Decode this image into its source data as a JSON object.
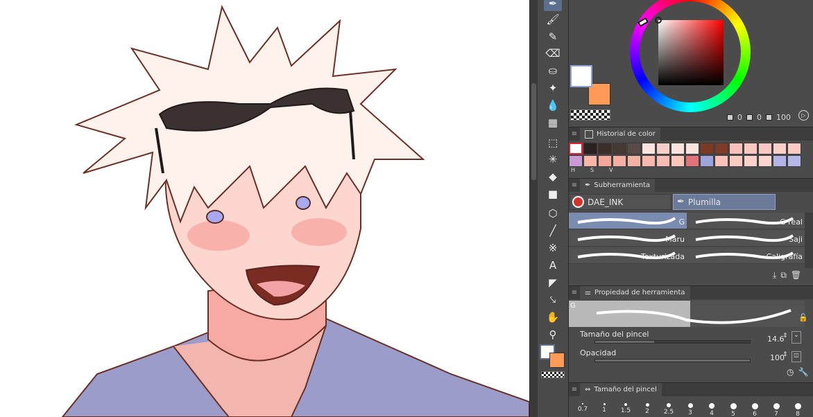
{
  "canvas": {
    "artwork": "illustration of a white-haired young man with sunglasses on his head"
  },
  "color_panel": {
    "hsv_h": "0",
    "hsv_s": "0",
    "hsv_v": "100",
    "main_color": "#ffffff",
    "sub_color": "#ff9a57"
  },
  "color_history": {
    "title": "Historial de color",
    "row1": [
      "#ffffff",
      "#2b2220",
      "#3e2e2b",
      "#463835",
      "#5a4b48",
      "#fde3dd",
      "#f6d0c6",
      "#fce4dc",
      "#fde5de",
      "#7a3a24",
      "#7e3c28",
      "#f9c2b8",
      "#fbc9c1",
      "#fcc8c2",
      "#fdd0c8",
      "#fdcbc3"
    ],
    "row2": [
      "#c99ad3",
      "#f8b6a8",
      "#f5a79a",
      "#f3b0a3",
      "#f4b2a5",
      "#f7b8ad",
      "#f7bdb2",
      "#fbc6bc",
      "#e0747a",
      "#9fa5dc",
      "#f8c2b8",
      "#fbcbc2",
      "#fbd2c9",
      "#fcd7cf",
      "#b4b4e8",
      "#b8b7e9"
    ],
    "labels": [
      "H",
      "S",
      "V"
    ]
  },
  "subtool": {
    "title": "Subherramienta",
    "group1": "DAE_INK",
    "group2": "Plumilla",
    "brushes": [
      {
        "left": "G",
        "right": "G real"
      },
      {
        "left": "Maru",
        "right": "Saji"
      },
      {
        "left": "Texturizada",
        "right": "Caligrafía"
      }
    ]
  },
  "tool_property": {
    "title": "Propiedad de herramienta",
    "preview_tag": "G",
    "brush_size_label": "Tamaño del pincel",
    "brush_size_value": "14.6",
    "opacity_label": "Opacidad",
    "opacity_value": "100"
  },
  "brush_size_panel": {
    "title": "Tamaño del pincel",
    "sizes": [
      "0.7",
      "1",
      "1.5",
      "2",
      "2.5",
      "3",
      "4",
      "5",
      "6",
      "7",
      "8"
    ]
  },
  "accent": "#5d6f8f"
}
